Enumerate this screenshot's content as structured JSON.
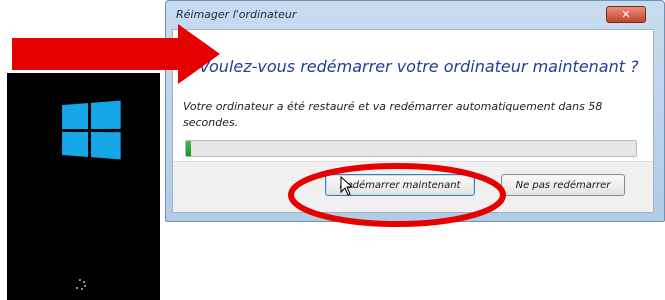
{
  "dialog": {
    "title": "Réimager l'ordinateur",
    "close_glyph": "✕",
    "heading": "Voulez-vous redémarrer votre ordinateur maintenant ?",
    "message": "Votre ordinateur a été restauré et va redémarrer automatiquement dans 58 secondes.",
    "progress_fraction": 0.01,
    "buttons": {
      "restart_now": "Redémarrer maintenant",
      "dont_restart": "Ne pas redémarrer"
    }
  },
  "boot_screen": {
    "logo_color": "#16a7e8",
    "background": "#000000"
  },
  "annotations": {
    "arrow_color": "#e60000",
    "ellipse_color": "#e60000"
  },
  "icons": [
    "windows-logo-icon",
    "loading-spinner-icon",
    "close-icon",
    "mouse-pointer-icon"
  ]
}
